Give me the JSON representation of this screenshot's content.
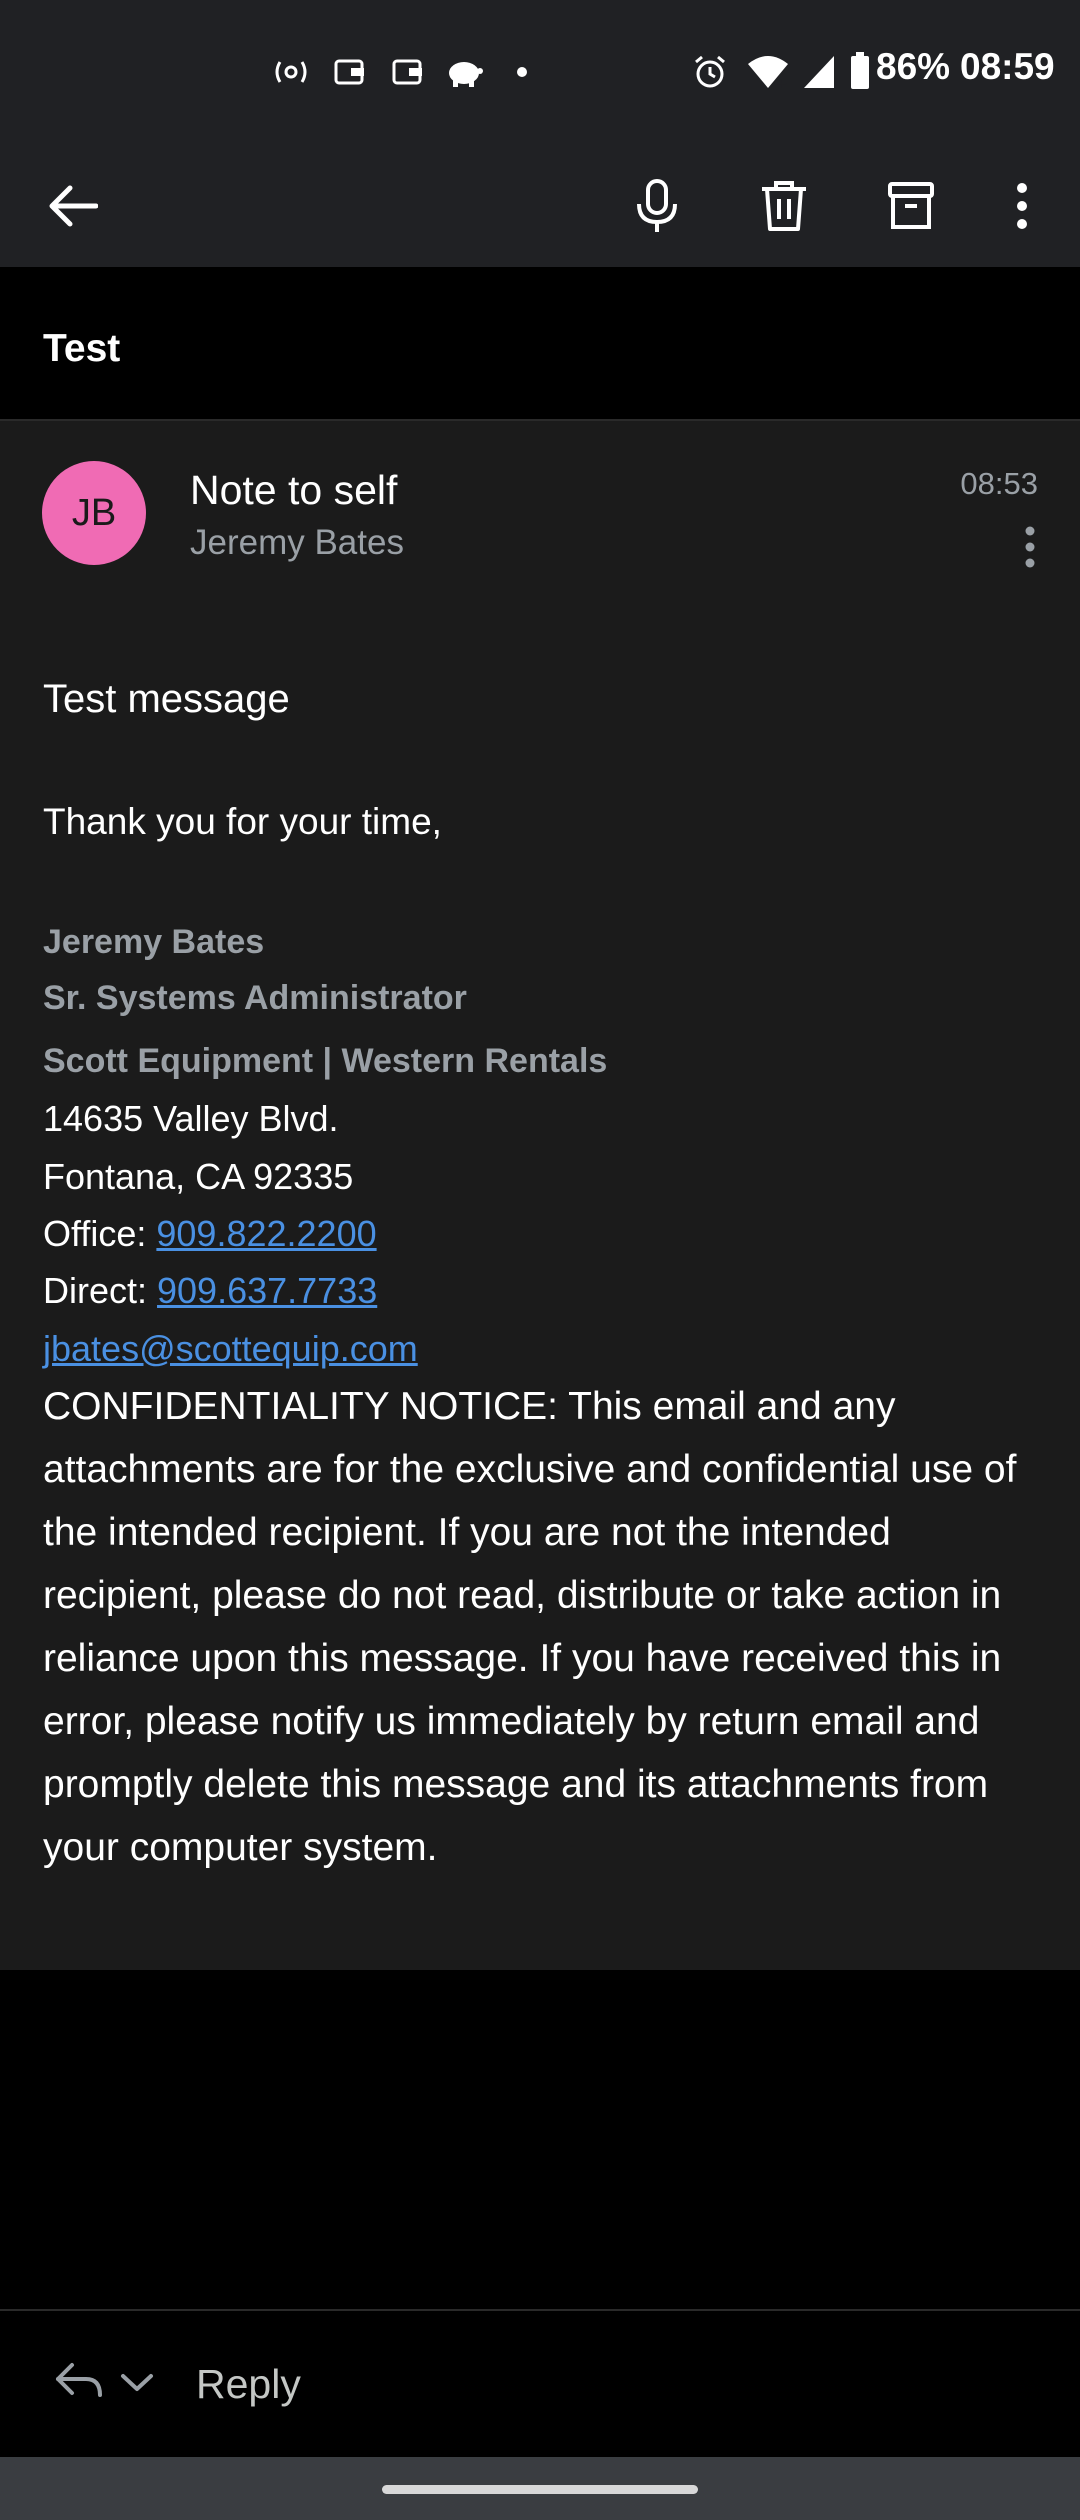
{
  "status_bar": {
    "battery": "86%",
    "time": "08:59",
    "icons": [
      "radio-icon",
      "wallet-icon",
      "wallet-icon",
      "piggy-bank-icon",
      "dot-icon",
      "alarm-icon",
      "wifi-icon",
      "signal-icon",
      "battery-icon"
    ]
  },
  "toolbar": {
    "icons": [
      "back-arrow-icon",
      "microphone-icon",
      "trash-icon",
      "archive-icon",
      "more-vert-icon"
    ]
  },
  "subject": "Test",
  "message": {
    "avatar_initials": "JB",
    "avatar_color": "#f06bb4",
    "sender": "Note to self",
    "from": "Jeremy Bates",
    "time": "08:53",
    "body_line1": "Test message",
    "body_line2": "Thank you for your time,",
    "signature": {
      "name": "Jeremy Bates",
      "title": "Sr. Systems Administrator",
      "company": "Scott Equipment | Western Rentals",
      "address1": "14635 Valley Blvd.",
      "address2": "Fontana, CA 92335",
      "office_label": "Office: ",
      "office_phone": "909.822.2200",
      "direct_label": "Direct: ",
      "direct_phone": "909.637.7733",
      "email": "jbates@scottequip.com"
    },
    "notice": "CONFIDENTIALITY NOTICE: This email and any attachments are for the exclusive and confidential use of the intended recipient. If you are not the intended recipient, please do not read, distribute or take action in reliance upon this message. If you have received this in error, please notify us immediately by return email and promptly delete this message and its attachments from your computer system."
  },
  "reply": {
    "label": "Reply"
  },
  "colors": {
    "link": "#4a90e2",
    "toolbar_bg": "#202124",
    "card_bg": "#1b1b1b"
  }
}
